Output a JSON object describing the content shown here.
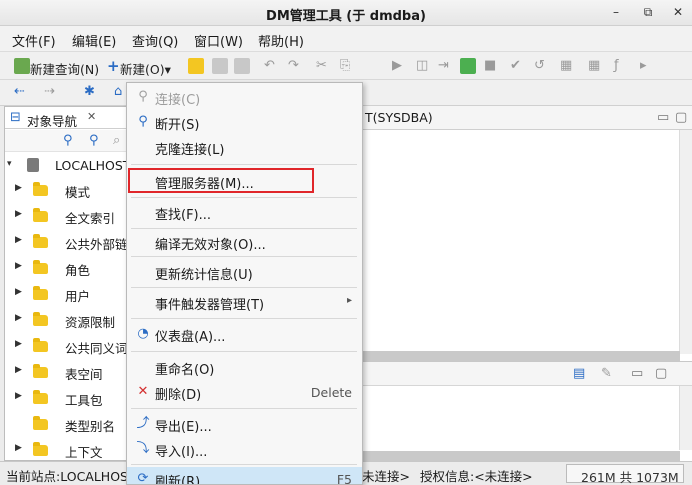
{
  "window": {
    "title": "DM管理工具 (于 dmdba)",
    "minimize": "–",
    "restore": "⧉",
    "close": "✕"
  },
  "menubar": [
    {
      "label": "文件(F)"
    },
    {
      "label": "编辑(E)"
    },
    {
      "label": "查询(Q)"
    },
    {
      "label": "窗口(W)"
    },
    {
      "label": "帮助(H)"
    }
  ],
  "toolbar": {
    "new_query": "新建查询(N)",
    "new": "新建(O)▾"
  },
  "navigator": {
    "tab_label": "对象导航",
    "root": "LOCALHOST",
    "items": [
      {
        "label": "模式"
      },
      {
        "label": "全文索引"
      },
      {
        "label": "公共外部链"
      },
      {
        "label": "角色"
      },
      {
        "label": "用户"
      },
      {
        "label": "资源限制"
      },
      {
        "label": "公共同义词"
      },
      {
        "label": "表空间"
      },
      {
        "label": "工具包"
      },
      {
        "label": "类型别名"
      },
      {
        "label": "上下文"
      }
    ]
  },
  "editor": {
    "tab_label": "T(SYSDBA)"
  },
  "status": {
    "site": "当前站点:LOCALHOST",
    "connect": "未连接>",
    "auth": "授权信息:<未连接>",
    "memory": "261M 共 1073M"
  },
  "context_menu": {
    "items": [
      {
        "label": "连接(C)",
        "icon": "connect-icon",
        "disabled": true
      },
      {
        "label": "断开(S)",
        "icon": "disconnect-icon"
      },
      {
        "label": "克隆连接(L)"
      },
      {
        "label": "管理服务器(M)..."
      },
      {
        "label": "查找(F)..."
      },
      {
        "label": "编译无效对象(O)..."
      },
      {
        "label": "更新统计信息(U)"
      },
      {
        "label": "事件触发器管理(T)",
        "submenu": "▸"
      },
      {
        "label": "仪表盘(A)...",
        "icon": "dashboard-icon"
      },
      {
        "label": "重命名(O)"
      },
      {
        "label": "删除(D)",
        "accel": "Delete",
        "icon": "delete-icon"
      },
      {
        "label": "导出(E)...",
        "icon": "export-icon"
      },
      {
        "label": "导入(I)...",
        "icon": "import-icon"
      },
      {
        "label": "刷新(R)",
        "accel": "F5",
        "icon": "refresh-icon"
      }
    ]
  },
  "colors": {
    "highlight_box": "#e0262a",
    "folder": "#f3c622",
    "menu_hover": "#cfe6f7"
  }
}
